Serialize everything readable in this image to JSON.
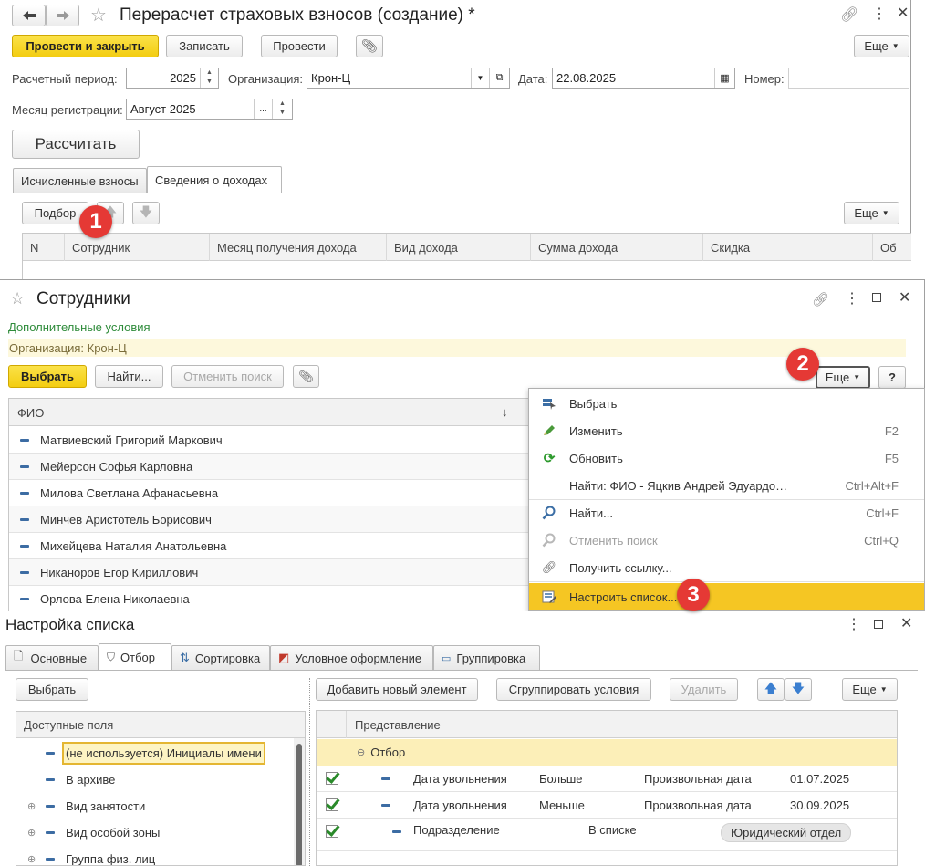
{
  "doc": {
    "title": "Перерасчет страховых взносов (создание) *",
    "buttons": {
      "post_close": "Провести и закрыть",
      "save": "Записать",
      "post": "Провести",
      "more": "Еще"
    },
    "period_label": "Расчетный период:",
    "period_value": "2025",
    "org_label": "Организация:",
    "org_value": "Крон-Ц",
    "date_label": "Дата:",
    "date_value": "22.08.2025",
    "number_label": "Номер:",
    "number_value": "",
    "reg_month_label": "Месяц регистрации:",
    "reg_month_value": "Август 2025",
    "calc_button": "Рассчитать",
    "tabs": [
      "Исчисленные взносы",
      "Сведения о доходах"
    ],
    "pick_button": "Подбор",
    "more2": "Еще",
    "columns": [
      "N",
      "Сотрудник",
      "Месяц получения дохода",
      "Вид дохода",
      "Сумма дохода",
      "Скидка",
      "Об"
    ]
  },
  "employees": {
    "title": "Сотрудники",
    "extra_conditions": "Дополнительные условия",
    "org_filter": "Организация: Крон-Ц",
    "buttons": {
      "select": "Выбрать",
      "find": "Найти...",
      "cancel_find": "Отменить поиск",
      "more": "Еще",
      "help": "?"
    },
    "column": "ФИО",
    "sort_arrow": "↓",
    "rows": [
      "Матвиевский Григорий Маркович",
      "Мейерсон Софья Карловна",
      "Милова Светлана Афанасьевна",
      "Минчев Аристотель Борисович",
      "Михейцева Наталия Анатольевна",
      "Никаноров Егор Кириллович",
      "Орлова Елена Николаевна"
    ]
  },
  "menu": {
    "items": [
      {
        "label": "Выбрать",
        "shortcut": "",
        "icon": "select-icon"
      },
      {
        "label": "Изменить",
        "shortcut": "F2",
        "icon": "pencil-icon"
      },
      {
        "label": "Обновить",
        "shortcut": "F5",
        "icon": "refresh-icon"
      },
      {
        "label": "Найти: ФИО - Яцкив Андрей Эдуардо…",
        "shortcut": "Ctrl+Alt+F",
        "icon": ""
      },
      {
        "label": "Найти...",
        "shortcut": "Ctrl+F",
        "icon": "search-icon"
      },
      {
        "label": "Отменить поиск",
        "shortcut": "Ctrl+Q",
        "icon": "cancel-search-icon"
      },
      {
        "label": "Получить ссылку...",
        "shortcut": "",
        "icon": "link-icon"
      },
      {
        "label": "Настроить список...",
        "shortcut": "",
        "icon": "configure-list-icon"
      }
    ]
  },
  "badges": [
    "1",
    "2",
    "3"
  ],
  "settings": {
    "title": "Настройка списка",
    "tabs": [
      "Основные",
      "Отбор",
      "Сортировка",
      "Условное оформление",
      "Группировка"
    ],
    "select_button": "Выбрать",
    "available_fields_header": "Доступные поля",
    "fields": [
      "(не используется) Инициалы имени",
      "В архиве",
      "Вид занятости",
      "Вид особой зоны",
      "Группа физ. лиц"
    ],
    "buttons": {
      "add": "Добавить новый элемент",
      "group": "Сгруппировать условия",
      "delete": "Удалить",
      "more": "Еще"
    },
    "repr_header": "Представление",
    "group_label": "Отбор",
    "conditions": [
      {
        "field": "Дата увольнения",
        "op": "Больше",
        "kind": "Произвольная дата",
        "value": "01.07.2025"
      },
      {
        "field": "Дата увольнения",
        "op": "Меньше",
        "kind": "Произвольная дата",
        "value": "30.09.2025"
      },
      {
        "field": "Подразделение",
        "op": "В списке",
        "kind": "",
        "value": "Юридический отдел"
      }
    ]
  },
  "colors": {
    "accent_yellow": "#f5d11a",
    "badge_red": "#e53935",
    "green_link": "#2e8b3a",
    "filter_bg": "#fdf8dc"
  }
}
